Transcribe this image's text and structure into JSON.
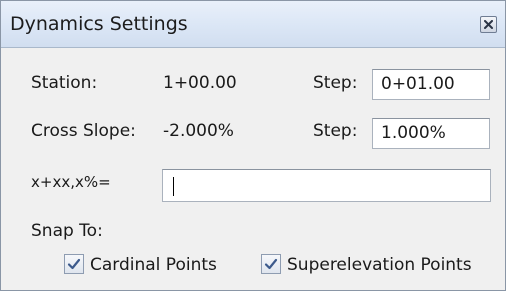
{
  "window": {
    "title": "Dynamics Settings"
  },
  "station": {
    "label": "Station:",
    "value": "1+00.00",
    "step_label": "Step:",
    "step_value": "0+01.00"
  },
  "cross_slope": {
    "label": "Cross Slope:",
    "value": "-2.000%",
    "step_label": "Step:",
    "step_value": "1.000%"
  },
  "entry": {
    "label": "x+xx,x%=",
    "value": ""
  },
  "snap": {
    "label": "Snap To:",
    "cardinal_points": {
      "label": "Cardinal Points",
      "checked": true
    },
    "superelevation_points": {
      "label": "Superelevation Points",
      "checked": true
    }
  },
  "icons": {
    "close": "close-icon",
    "check": "checkmark-icon"
  },
  "colors": {
    "titlebar": "#dce7f6",
    "body": "#f0f0f0",
    "border": "#8a96a6",
    "check": "#3c5a8c"
  }
}
